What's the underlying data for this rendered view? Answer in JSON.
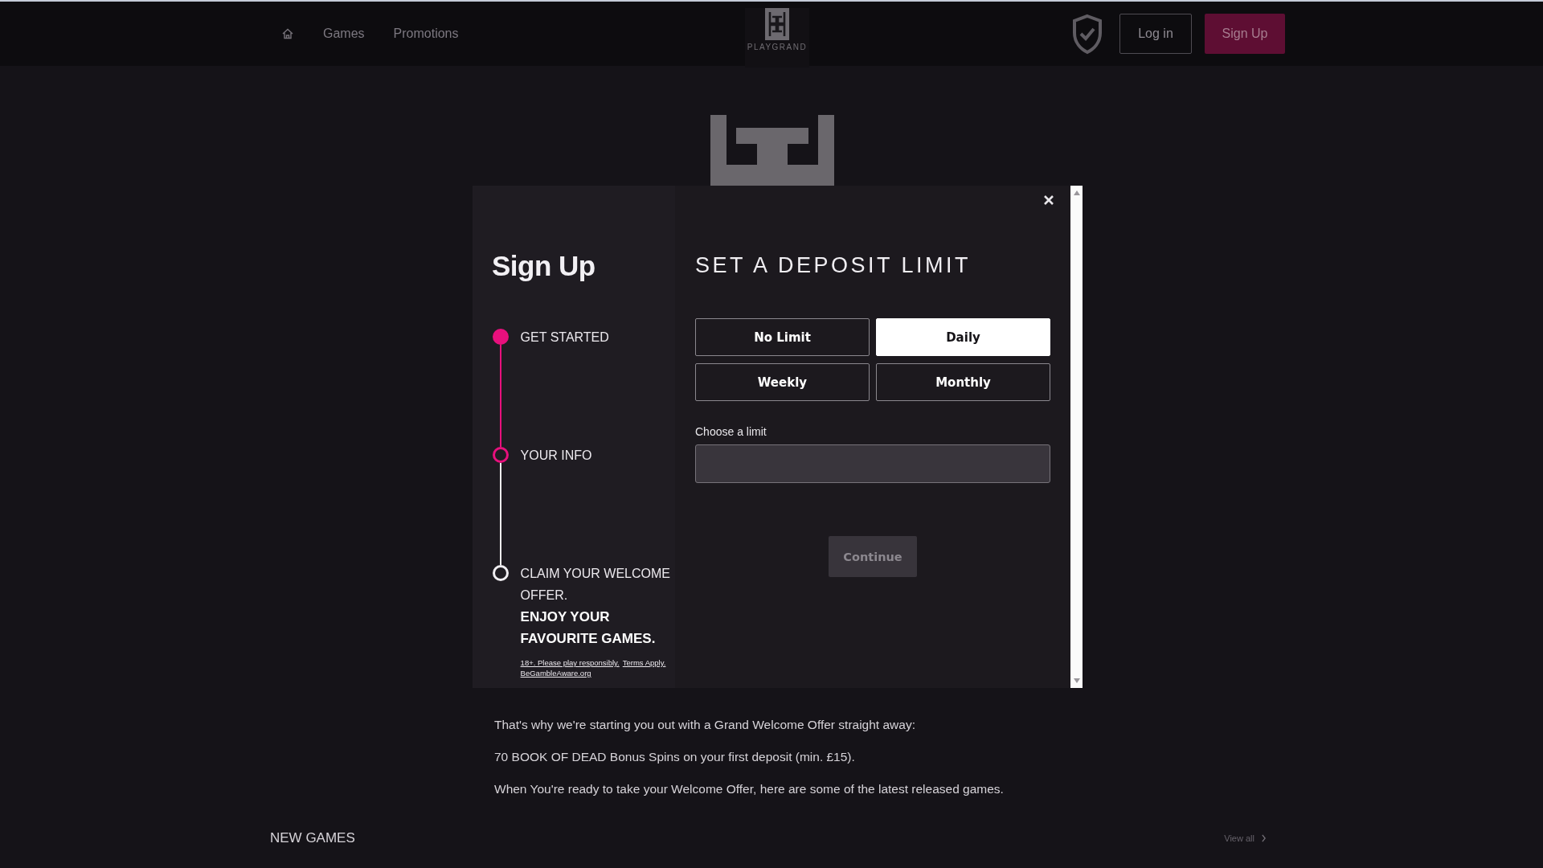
{
  "header": {
    "nav": [
      "Games",
      "Promotions"
    ],
    "logo_text": "PLAYGRAND",
    "login": "Log in",
    "signup": "Sign Up"
  },
  "modal": {
    "title": "Sign Up",
    "steps": [
      {
        "label": "GET STARTED",
        "done": true,
        "active": false
      },
      {
        "label": "YOUR INFO",
        "done": false,
        "active": true
      },
      {
        "label": "CLAIM YOUR WELCOME OFFER.",
        "done": false,
        "active": false
      }
    ],
    "tagline": "ENJOY YOUR FAVOURITE GAMES.",
    "legal_links": [
      "18+. Please play responsibly.",
      "Terms Apply.",
      "BeGambleAware.org"
    ],
    "heading": "SET A DEPOSIT LIMIT",
    "options": [
      {
        "label": "No Limit",
        "selected": false
      },
      {
        "label": "Daily",
        "selected": true
      },
      {
        "label": "Weekly",
        "selected": false
      },
      {
        "label": "Monthly",
        "selected": false
      }
    ],
    "limit_label": "Choose a limit",
    "continue": {
      "label": "Continue",
      "disabled": true
    }
  },
  "content": {
    "paragraphs": [
      "That's why we're starting you out with a Grand Welcome Offer straight away:",
      "70 BOOK OF DEAD Bonus Spins on your first deposit (min. £15).",
      "When You're ready to take your Welcome Offer, here are some of the latest released games."
    ],
    "section_title": "NEW GAMES",
    "view_all": "View all"
  }
}
